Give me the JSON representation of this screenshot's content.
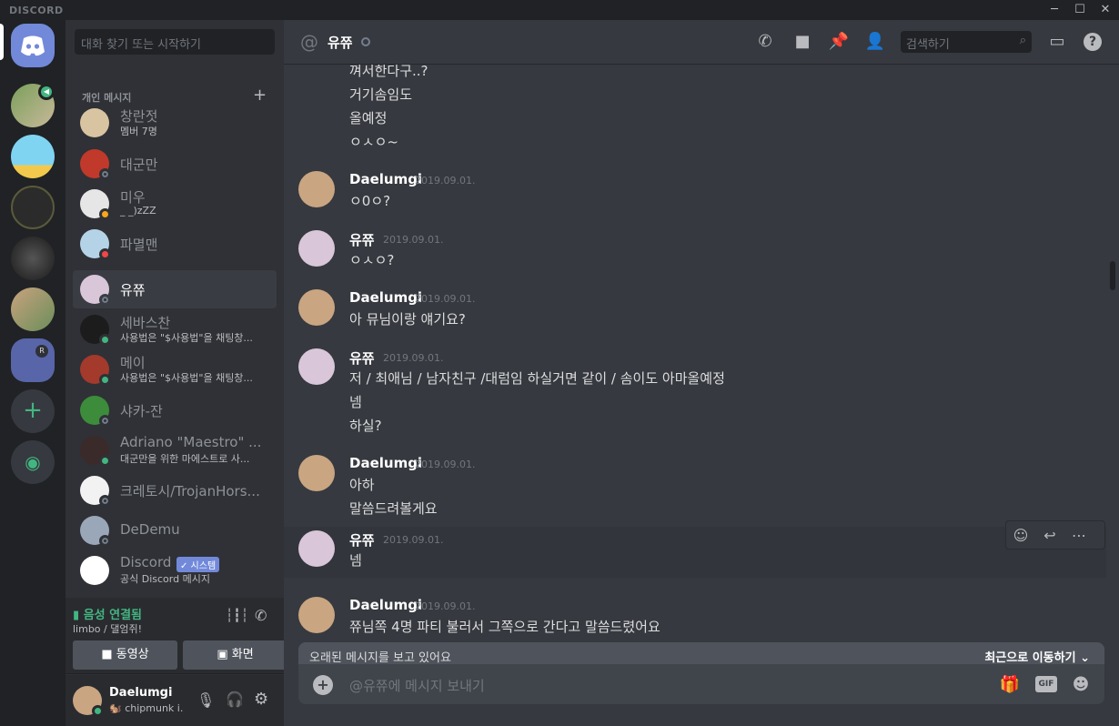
{
  "window": {
    "brand": "DISCORD",
    "minimize": "─",
    "maximize": "☐",
    "close": "✕"
  },
  "guilds": {
    "add": "+",
    "explore": "◉",
    "folder_badge": "R"
  },
  "dm_list": {
    "search_placeholder": "대화 찾기 또는 시작하기",
    "header": "개인 메시지",
    "add": "+",
    "items": [
      {
        "name": "창란젓",
        "sub": "멤버 7명",
        "status": "",
        "avatar_color": "#d8c4a0"
      },
      {
        "name": "대군만",
        "sub": "",
        "status": "off",
        "avatar_color": "#c0392b"
      },
      {
        "name": "미우",
        "sub": "_ _)zZZ",
        "status": "idle",
        "avatar_color": "#e6e6e6"
      },
      {
        "name": "파멸맨",
        "sub": "",
        "status": "dnd",
        "avatar_color": "#b5d3e7"
      },
      {
        "name": "유쮸",
        "sub": "",
        "status": "off",
        "avatar_color": "#d9c6d8"
      },
      {
        "name": "세바스찬",
        "sub": "사용법은 \"$사용법\"을 채팅창...",
        "status": "on",
        "avatar_color": "#1c1c1c"
      },
      {
        "name": "메이",
        "sub": "사용법은 \"$사용법\"을 채팅창...",
        "status": "on",
        "avatar_color": "#a33a2c"
      },
      {
        "name": "샤카-잔",
        "sub": "",
        "status": "off",
        "avatar_color": "#3c8c3c"
      },
      {
        "name": "Adriano \"Maestro\" ...",
        "sub": "대군만을 위한 마에스트로 사...",
        "status": "on",
        "avatar_color": "#3b2a2a"
      },
      {
        "name": "크레토시/TrojanHors...",
        "sub": "",
        "status": "off",
        "avatar_color": "#f2f2f2"
      },
      {
        "name": "DeDemu",
        "sub": "",
        "status": "off",
        "avatar_color": "#9aa7b8"
      },
      {
        "name": "Discord",
        "sub": "공식 Discord 메시지",
        "status": "",
        "avatar_color": "#ffffff",
        "badge": "✓ 시스템"
      }
    ]
  },
  "voice": {
    "title": "음성 연결됨",
    "channel": "limbo / 댈엄쥐!",
    "video_label": "동영상",
    "screen_label": "화면"
  },
  "user": {
    "name": "Daelumgi",
    "status": "🐿️ chipmunk i..."
  },
  "channel": {
    "name": "유쮸",
    "search_placeholder": "검색하기"
  },
  "messages": {
    "top_lines": [
      "껴서한다구..?",
      "거기솜임도",
      "올예정",
      "ㅇㅅㅇ~"
    ],
    "groups": [
      {
        "author": "Daelumgi",
        "time": "2019.09.01.",
        "lines": [
          "ㅇ0ㅇ?"
        ],
        "who": "d"
      },
      {
        "author": "유쮸",
        "time": "2019.09.01.",
        "lines": [
          "ㅇㅅㅇ?"
        ],
        "who": "y"
      },
      {
        "author": "Daelumgi",
        "time": "2019.09.01.",
        "lines": [
          "아 뮤님이랑 얘기요?"
        ],
        "who": "d"
      },
      {
        "author": "유쮸",
        "time": "2019.09.01.",
        "lines": [
          "저 / 최애님 / 남자친구 /대럼임 하실거면 같이 / 솜이도 아마올예정",
          "넴",
          "하실?"
        ],
        "who": "y"
      },
      {
        "author": "Daelumgi",
        "time": "2019.09.01.",
        "lines": [
          "아하",
          "말씀드려볼게요"
        ],
        "who": "d"
      },
      {
        "author": "유쮸",
        "time": "2019.09.01.",
        "lines": [
          "넴"
        ],
        "who": "y"
      },
      {
        "author": "Daelumgi",
        "time": "2019.09.01.",
        "lines": [
          "쮸님쪽 4명 파티 불러서 그쪽으로 간다고 말씀드렸어요"
        ],
        "who": "d"
      }
    ]
  },
  "old_banner": {
    "left": "오래된 메시지를 보고 있어요",
    "right": "최근으로 이동하기"
  },
  "composer": {
    "placeholder": "@유쮸에 메시지 보내기",
    "gif": "GIF"
  },
  "colors": {
    "accent": "#7289da",
    "online": "#43b581",
    "dnd": "#f04747",
    "idle": "#faa61a"
  }
}
